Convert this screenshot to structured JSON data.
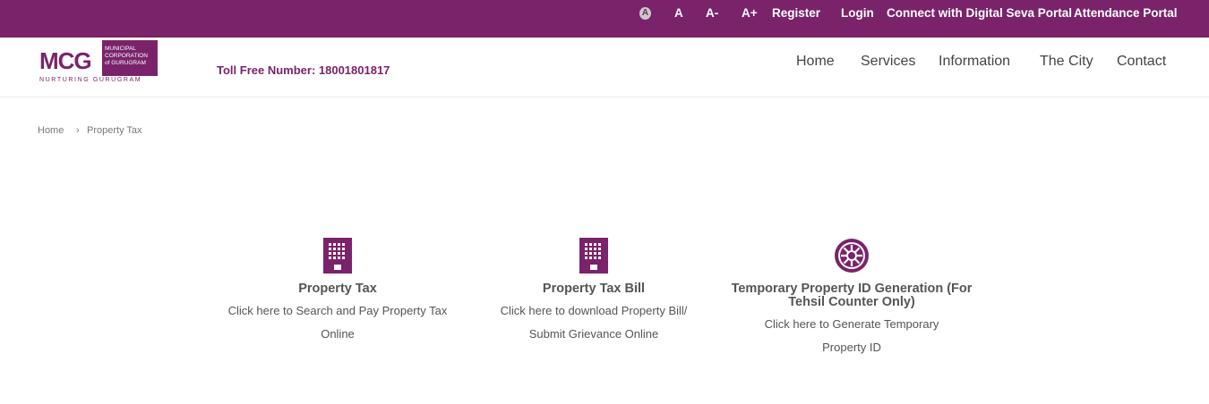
{
  "topbar": {
    "contrast_icon_letter": "A",
    "font_normal": "A",
    "font_decrease": "A-",
    "font_increase": "A+",
    "register": "Register",
    "login": "Login",
    "digital_seva": "Connect with Digital Seva Portal",
    "attendance": "Attendance Portal"
  },
  "logo": {
    "letters": "MCG",
    "line1": "MUNICIPAL",
    "line2": "CORPORATION",
    "line3": "of GURUGRAM",
    "tagline": "NURTURING GURUGRAM"
  },
  "header": {
    "toll_free": "Toll Free Number: 18001801817"
  },
  "nav": {
    "home": "Home",
    "services": "Services",
    "information": "Information",
    "city": "The City",
    "contact": "Contact"
  },
  "breadcrumb": {
    "home": "Home",
    "separator": "›",
    "current": "Property Tax"
  },
  "cards": [
    {
      "icon": "building-icon",
      "title": "Property Tax",
      "description": "Click here to Search and Pay Property Tax Online"
    },
    {
      "icon": "building-icon",
      "title": "Property Tax Bill",
      "description": "Click here to download Property Bill/ Submit Grievance Online"
    },
    {
      "icon": "emblem-icon",
      "title": "Temporary Property ID Generation (For Tehsil Counter Only)",
      "description": "Click here to Generate Temporary Property ID"
    }
  ],
  "colors": {
    "brand": "#7a236a",
    "text": "#555555",
    "nav_text": "#444444"
  }
}
